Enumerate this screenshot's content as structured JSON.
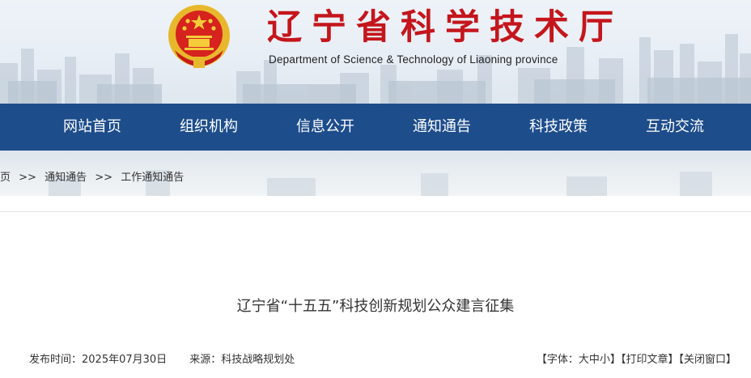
{
  "header": {
    "title": "辽宁省科学技术厅",
    "subtitle": "Department of Science & Technology of Liaoning province",
    "emblem_icon": "national-emblem-icon",
    "title_color": "#c4161c"
  },
  "nav": {
    "bg_color": "#1d4d8b",
    "items": [
      {
        "label": "网站首页"
      },
      {
        "label": "组织机构"
      },
      {
        "label": "信息公开"
      },
      {
        "label": "通知通告"
      },
      {
        "label": "科技政策"
      },
      {
        "label": "互动交流"
      }
    ]
  },
  "breadcrumb": {
    "items": [
      "页",
      ">>",
      "通知通告",
      ">>",
      "工作通知通告"
    ]
  },
  "article": {
    "title": "辽宁省“十五五”科技创新规划公众建言征集",
    "publish_label": "发布时间：",
    "publish_date": "2025年07月30日",
    "source_label": "来源：",
    "source": "科技战略规划处",
    "tools": {
      "font_open": "【字体：",
      "font_large": "大",
      "font_medium": "中",
      "font_small": "小",
      "font_close": "】",
      "print": "【打印文章】",
      "close": "【关闭窗口】"
    }
  }
}
